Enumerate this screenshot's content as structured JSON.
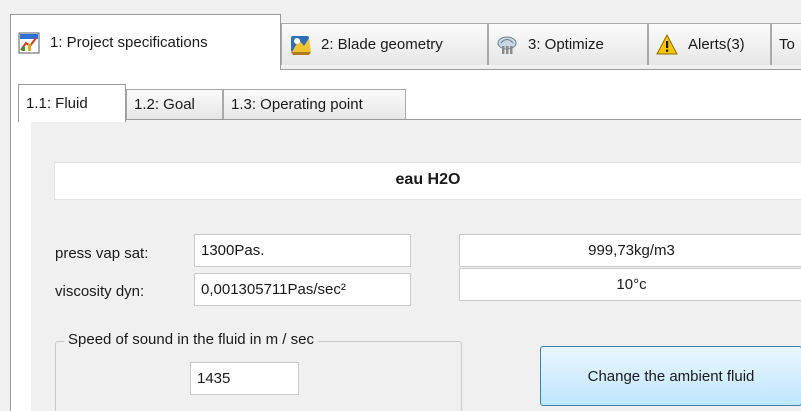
{
  "main_tabs": [
    {
      "label": "1: Project specifications",
      "icon": "project-chart-icon",
      "active": true
    },
    {
      "label": "2: Blade geometry",
      "icon": "blade-geometry-icon",
      "active": false
    },
    {
      "label": "3: Optimize",
      "icon": "optimize-icon",
      "active": false
    },
    {
      "label": "Alerts(3)",
      "icon": "warning-icon",
      "active": false
    },
    {
      "label": "To",
      "icon": "",
      "active": false
    }
  ],
  "sub_tabs": [
    {
      "label": "1.1: Fluid",
      "active": true
    },
    {
      "label": "1.2: Goal",
      "active": false
    },
    {
      "label": "1.3: Operating point",
      "active": false
    }
  ],
  "fluid": {
    "name": "eau H2O",
    "press_vap_sat_label": "press vap sat:",
    "press_vap_sat_value": "1300Pas.",
    "viscosity_label": "viscosity dyn:",
    "viscosity_value": "0,001305711Pas/sec²",
    "density_value": "999,73kg/m3",
    "temperature_value": "10°c"
  },
  "sound": {
    "group_title": "Speed of sound in the fluid in m / sec",
    "value": "1435"
  },
  "change_fluid_button": "Change the ambient fluid",
  "colors": {
    "window_bg": "#f0f0f0",
    "tab_border": "#9a9a9a",
    "button_border": "#3c7fb1",
    "button_fill": "#bee6fd",
    "warning_yellow": "#f6c400"
  }
}
